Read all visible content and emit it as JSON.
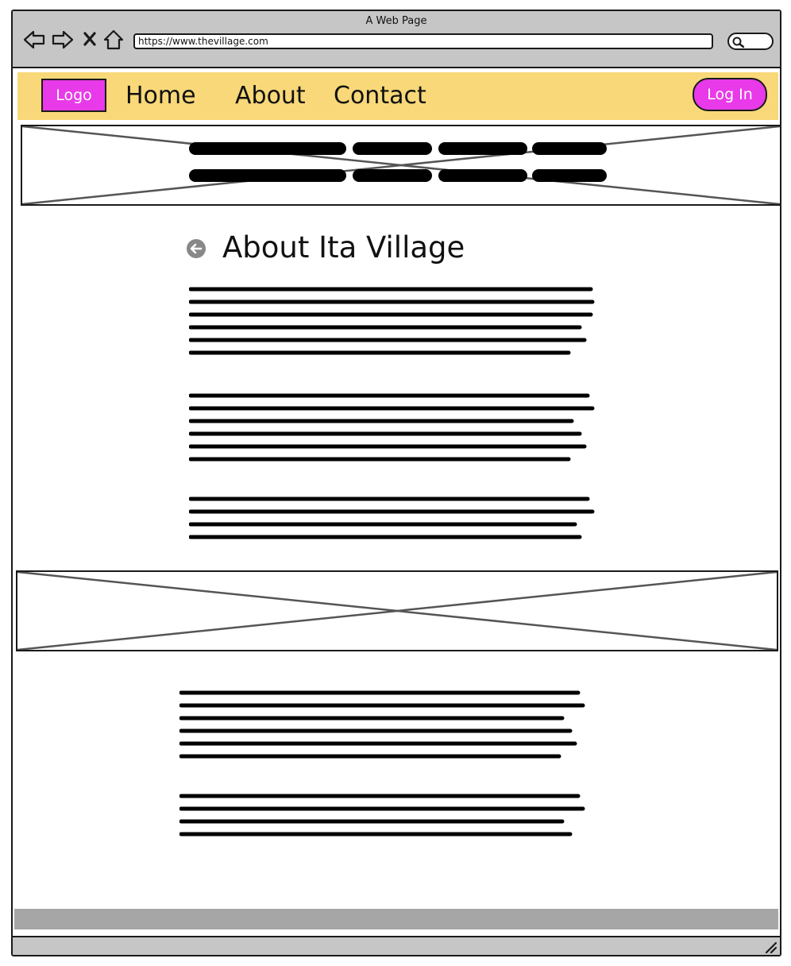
{
  "window": {
    "title": "A Web Page",
    "url": "https://www.thevillage.com"
  },
  "toolbar": {
    "back_icon": "back-arrow-icon",
    "forward_icon": "forward-arrow-icon",
    "stop_icon": "close-icon",
    "home_icon": "home-icon",
    "search_icon": "search-icon"
  },
  "navbar": {
    "logo_label": "Logo",
    "links": [
      "Home",
      "About",
      "Contact"
    ],
    "login_label": "Log In"
  },
  "main": {
    "title": "About Ita Village",
    "back_icon": "back-circle-icon"
  },
  "colors": {
    "chrome": "#c6c6c6",
    "navbar": "#f8d878",
    "accent": "#e83ae8",
    "footer": "#a6a6a6",
    "ink": "#1a1a1a"
  }
}
